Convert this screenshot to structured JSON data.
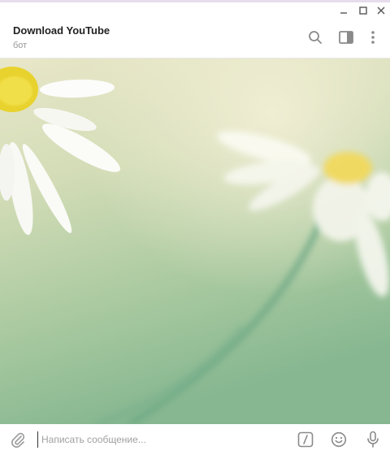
{
  "window": {
    "controls": [
      "minimize-icon",
      "maximize-icon",
      "close-icon"
    ],
    "accent_color": "#e6dcec"
  },
  "header": {
    "title": "Download YouTube",
    "subtitle": "бот",
    "actions": [
      "search-icon",
      "sidebar-toggle-icon",
      "more-vertical-icon"
    ]
  },
  "chat": {
    "background": "chamomile-flowers-wallpaper",
    "background_colors": [
      "#e8e6c8",
      "#c9d8b3",
      "#7fb48f"
    ]
  },
  "composer": {
    "placeholder": "Написать сообщение...",
    "value": "",
    "left_icons": [
      "paperclip-icon"
    ],
    "right_icons": [
      "bot-commands-icon",
      "emoji-icon",
      "microphone-icon"
    ]
  }
}
